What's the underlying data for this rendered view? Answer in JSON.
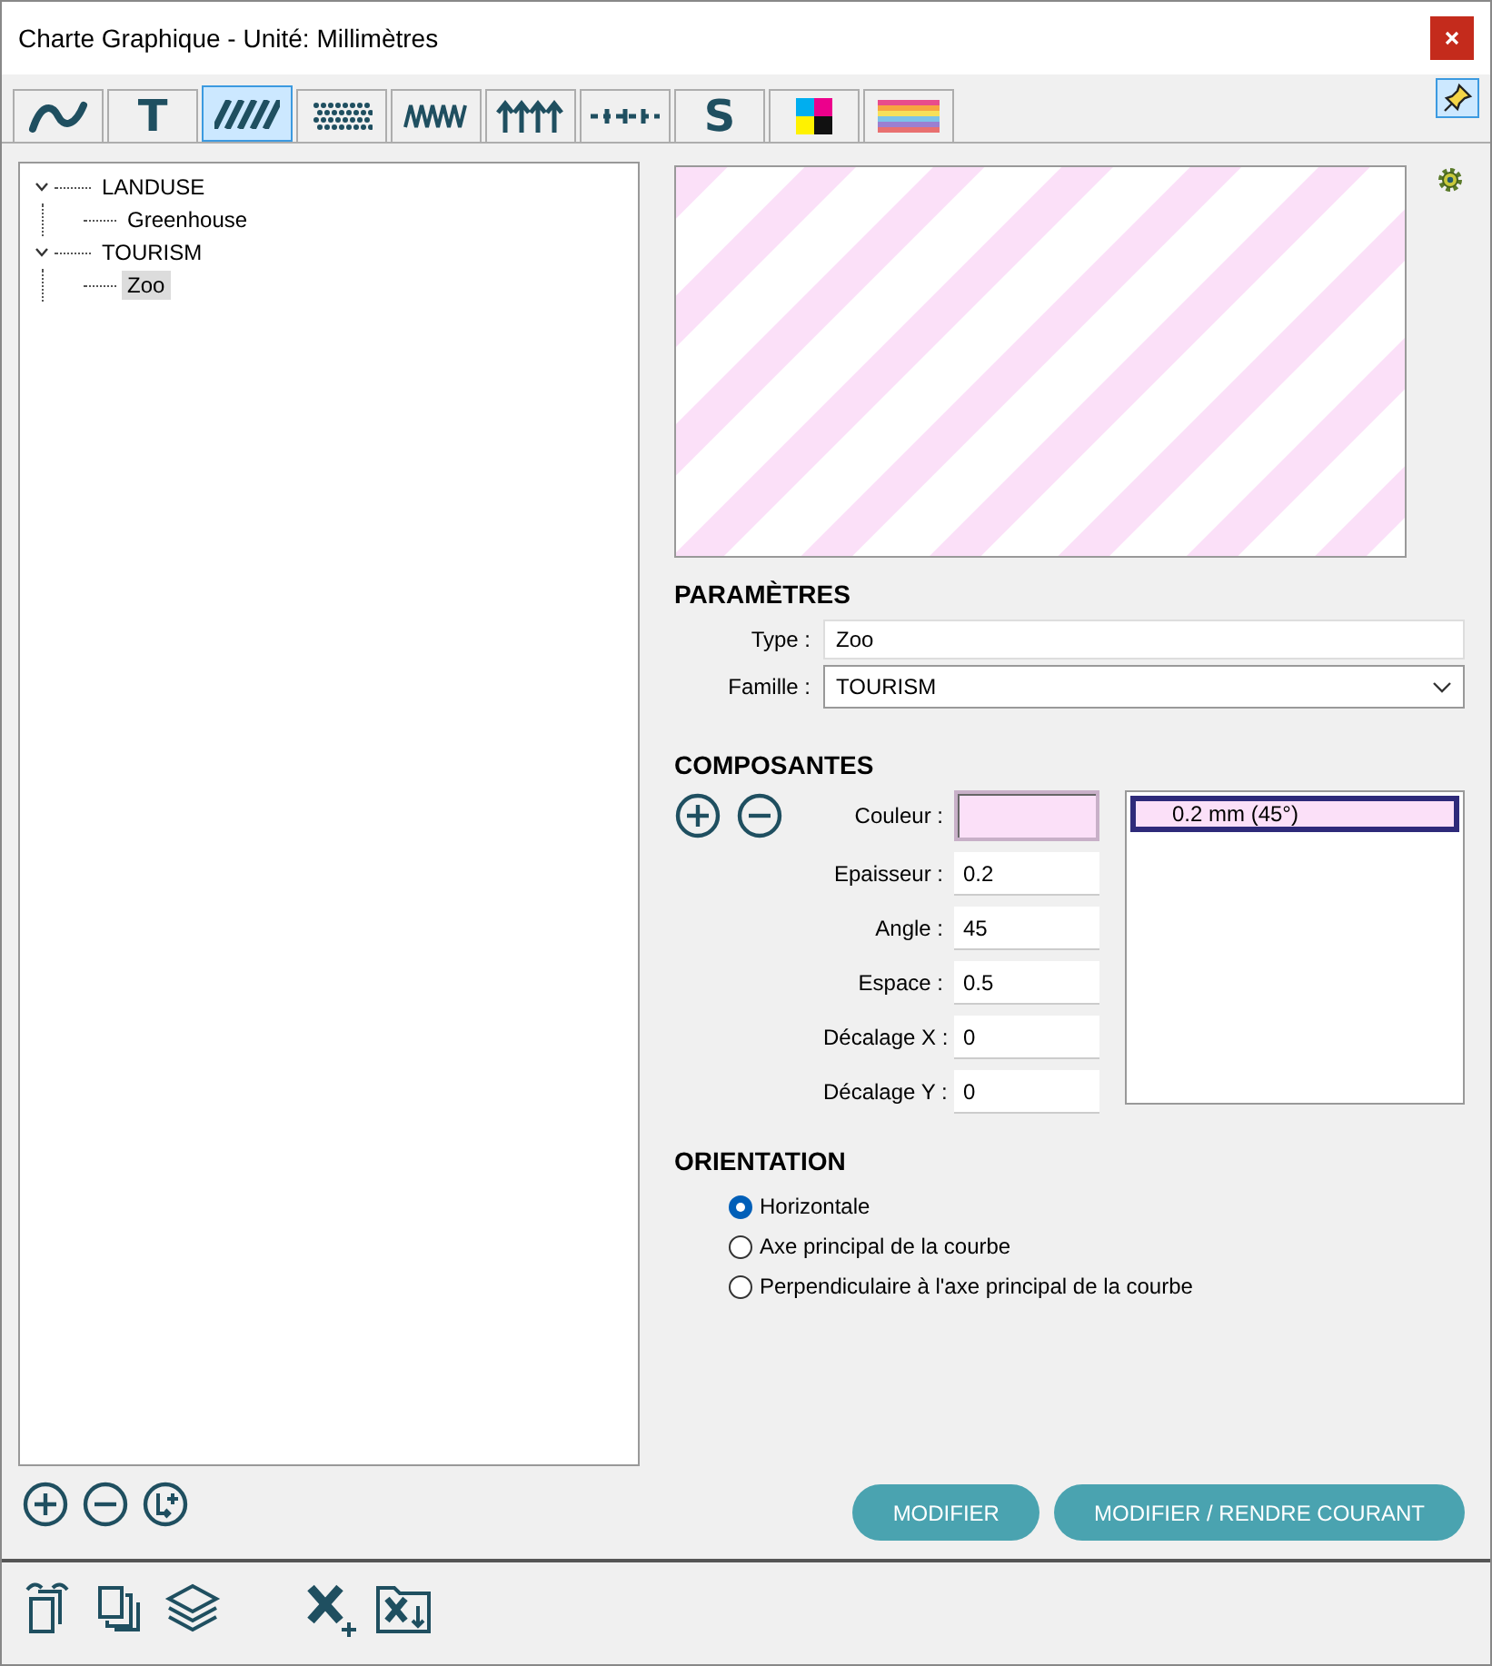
{
  "window": {
    "title": "Charte Graphique - Unité: Millimètres"
  },
  "tabs": [
    {
      "kind": "curve",
      "selected": false
    },
    {
      "kind": "text",
      "glyph": "T",
      "selected": false
    },
    {
      "kind": "hatch",
      "selected": true
    },
    {
      "kind": "dots",
      "selected": false
    },
    {
      "kind": "zigzag",
      "selected": false
    },
    {
      "kind": "arrows",
      "selected": false
    },
    {
      "kind": "dashes",
      "selected": false
    },
    {
      "kind": "text",
      "glyph": "S",
      "selected": false
    },
    {
      "kind": "cmyk",
      "selected": false
    },
    {
      "kind": "gradient",
      "selected": false
    }
  ],
  "pinned": true,
  "tree": [
    {
      "label": "LANDUSE",
      "expanded": true,
      "selected": false,
      "children": [
        {
          "label": "Greenhouse",
          "selected": false
        }
      ]
    },
    {
      "label": "TOURISM",
      "expanded": true,
      "selected": false,
      "children": [
        {
          "label": "Zoo",
          "selected": true
        }
      ]
    }
  ],
  "parameters": {
    "title": "PARAMÈTRES",
    "type_label": "Type :",
    "type_value": "Zoo",
    "family_label": "Famille :",
    "family_value": "TOURISM"
  },
  "components": {
    "title": "COMPOSANTES",
    "color_label": "Couleur :",
    "color": "#fbe0f8",
    "fields": [
      {
        "label": "Epaisseur :",
        "value": "0.2"
      },
      {
        "label": "Angle :",
        "value": "45"
      },
      {
        "label": "Espace :",
        "value": "0.5"
      },
      {
        "label": "Décalage X :",
        "value": "0"
      },
      {
        "label": "Décalage Y :",
        "value": "0"
      }
    ],
    "list": [
      {
        "label": "0.2 mm (45°)",
        "selected": true
      }
    ]
  },
  "orientation": {
    "title": "ORIENTATION",
    "options": [
      {
        "label": "Horizontale",
        "selected": true
      },
      {
        "label": "Axe principal de la courbe",
        "selected": false
      },
      {
        "label": "Perpendiculaire à l'axe principal de la courbe",
        "selected": false
      }
    ]
  },
  "buttons": [
    "MODIFIER",
    "MODIFIER / RENDRE COURANT"
  ]
}
